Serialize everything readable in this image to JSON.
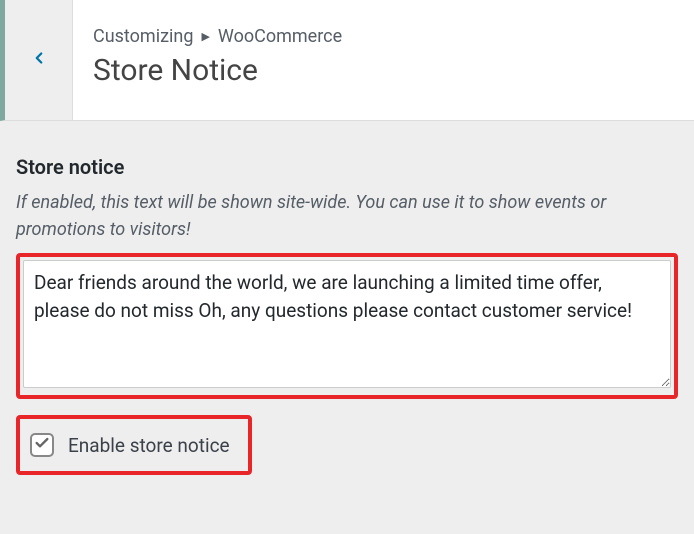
{
  "header": {
    "breadcrumb_root": "Customizing",
    "breadcrumb_parent": "WooCommerce",
    "title": "Store Notice"
  },
  "section": {
    "title": "Store notice",
    "description": "If enabled, this text will be shown site-wide. You can use it to show events or promotions to visitors!",
    "notice_text": "Dear friends around the world, we are launching a limited time offer, please do not miss Oh, any questions please contact customer service!",
    "enable_label": "Enable store notice",
    "enable_checked": true
  }
}
